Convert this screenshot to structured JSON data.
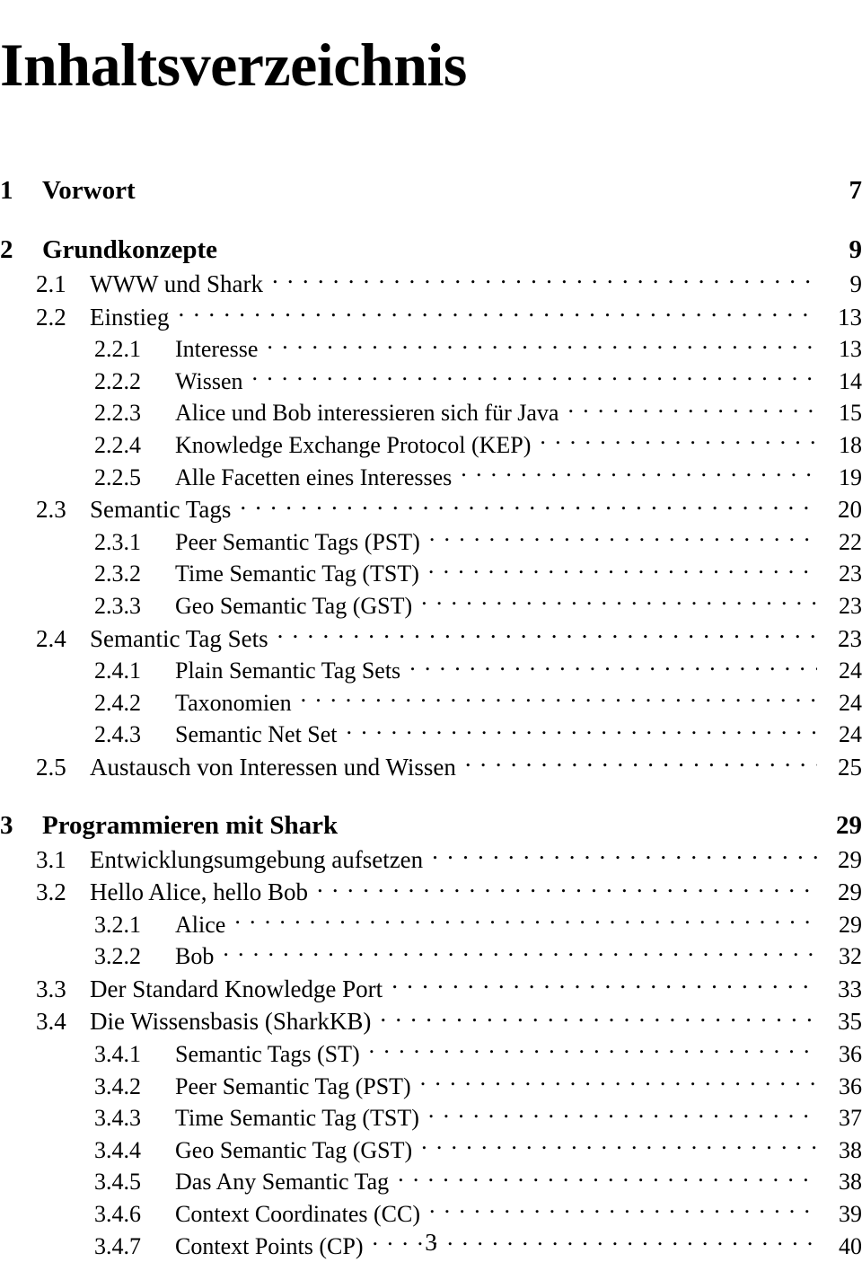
{
  "document": {
    "title": "Inhaltsverzeichnis",
    "folio": "3"
  },
  "toc": {
    "entries": [
      {
        "level": "chapter",
        "number": "1",
        "title": "Vorwort",
        "page": "7"
      },
      {
        "level": "chapter",
        "number": "2",
        "title": "Grundkonzepte",
        "page": "9"
      },
      {
        "level": "section",
        "number": "2.1",
        "title": "WWW und Shark",
        "page": "9"
      },
      {
        "level": "section",
        "number": "2.2",
        "title": "Einstieg",
        "page": "13"
      },
      {
        "level": "subsection",
        "number": "2.2.1",
        "title": "Interesse",
        "page": "13"
      },
      {
        "level": "subsection",
        "number": "2.2.2",
        "title": "Wissen",
        "page": "14"
      },
      {
        "level": "subsection",
        "number": "2.2.3",
        "title": "Alice und Bob interessieren sich für Java",
        "page": "15"
      },
      {
        "level": "subsection",
        "number": "2.2.4",
        "title": "Knowledge Exchange Protocol (KEP)",
        "page": "18"
      },
      {
        "level": "subsection",
        "number": "2.2.5",
        "title": "Alle Facetten eines Interesses",
        "page": "19"
      },
      {
        "level": "section",
        "number": "2.3",
        "title": "Semantic Tags",
        "page": "20"
      },
      {
        "level": "subsection",
        "number": "2.3.1",
        "title": "Peer Semantic Tags (PST)",
        "page": "22"
      },
      {
        "level": "subsection",
        "number": "2.3.2",
        "title": "Time Semantic Tag (TST)",
        "page": "23"
      },
      {
        "level": "subsection",
        "number": "2.3.3",
        "title": "Geo Semantic Tag (GST)",
        "page": "23"
      },
      {
        "level": "section",
        "number": "2.4",
        "title": "Semantic Tag Sets",
        "page": "23"
      },
      {
        "level": "subsection",
        "number": "2.4.1",
        "title": "Plain Semantic Tag Sets",
        "page": "24"
      },
      {
        "level": "subsection",
        "number": "2.4.2",
        "title": "Taxonomien",
        "page": "24"
      },
      {
        "level": "subsection",
        "number": "2.4.3",
        "title": "Semantic Net Set",
        "page": "24"
      },
      {
        "level": "section",
        "number": "2.5",
        "title": "Austausch von Interessen und Wissen",
        "page": "25"
      },
      {
        "level": "chapter",
        "number": "3",
        "title": "Programmieren mit Shark",
        "page": "29"
      },
      {
        "level": "section",
        "number": "3.1",
        "title": "Entwicklungsumgebung aufsetzen",
        "page": "29"
      },
      {
        "level": "section",
        "number": "3.2",
        "title": "Hello Alice, hello Bob",
        "page": "29"
      },
      {
        "level": "subsection",
        "number": "3.2.1",
        "title": "Alice",
        "page": "29"
      },
      {
        "level": "subsection",
        "number": "3.2.2",
        "title": "Bob",
        "page": "32"
      },
      {
        "level": "section",
        "number": "3.3",
        "title": "Der Standard Knowledge Port",
        "page": "33"
      },
      {
        "level": "section",
        "number": "3.4",
        "title": "Die Wissensbasis (SharkKB)",
        "page": "35"
      },
      {
        "level": "subsection",
        "number": "3.4.1",
        "title": "Semantic Tags (ST)",
        "page": "36"
      },
      {
        "level": "subsection",
        "number": "3.4.2",
        "title": "Peer Semantic Tag (PST)",
        "page": "36"
      },
      {
        "level": "subsection",
        "number": "3.4.3",
        "title": "Time Semantic Tag (TST)",
        "page": "37"
      },
      {
        "level": "subsection",
        "number": "3.4.4",
        "title": "Geo Semantic Tag (GST)",
        "page": "38"
      },
      {
        "level": "subsection",
        "number": "3.4.5",
        "title": "Das Any Semantic Tag",
        "page": "38"
      },
      {
        "level": "subsection",
        "number": "3.4.6",
        "title": "Context Coordinates (CC)",
        "page": "39"
      },
      {
        "level": "subsection",
        "number": "3.4.7",
        "title": "Context Points (CP)",
        "page": "40"
      }
    ]
  }
}
